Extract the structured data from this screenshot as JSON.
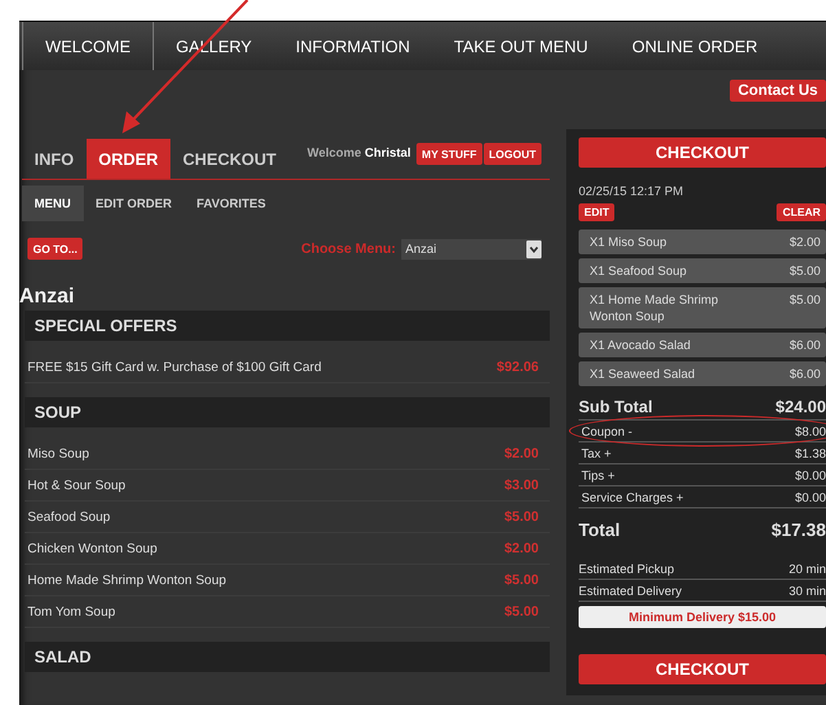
{
  "nav": [
    {
      "label": "WELCOME"
    },
    {
      "label": "GALLERY"
    },
    {
      "label": "INFORMATION"
    },
    {
      "label": "TAKE OUT MENU"
    },
    {
      "label": "ONLINE ORDER"
    }
  ],
  "contact_button": "Contact Us",
  "tabs": [
    {
      "label": "INFO",
      "selected": false
    },
    {
      "label": "ORDER",
      "selected": true
    },
    {
      "label": "CHECKOUT",
      "selected": false
    }
  ],
  "welcome": {
    "prefix": "Welcome",
    "name": "Christal"
  },
  "user_buttons": [
    "MY STUFF",
    "LOGOUT"
  ],
  "subtabs": [
    {
      "label": "MENU",
      "selected": true
    },
    {
      "label": "EDIT ORDER",
      "selected": false
    },
    {
      "label": "FAVORITES",
      "selected": false
    }
  ],
  "goto_button": "GO TO...",
  "choose_menu": {
    "label": "Choose Menu:",
    "value": "Anzai"
  },
  "menu_title": "Anzai",
  "sections": [
    {
      "title": "SPECIAL OFFERS",
      "items": [
        {
          "name": "FREE $15 Gift Card w. Purchase of $100 Gift Card",
          "price": "$92.06"
        }
      ]
    },
    {
      "title": "SOUP",
      "items": [
        {
          "name": "Miso Soup",
          "price": "$2.00"
        },
        {
          "name": "Hot & Sour Soup",
          "price": "$3.00"
        },
        {
          "name": "Seafood Soup",
          "price": "$5.00"
        },
        {
          "name": "Chicken Wonton Soup",
          "price": "$2.00"
        },
        {
          "name": "Home Made Shrimp Wonton Soup",
          "price": "$5.00"
        },
        {
          "name": "Tom Yom Soup",
          "price": "$5.00"
        }
      ]
    },
    {
      "title": "SALAD"
    }
  ],
  "cart": {
    "checkout_button": "CHECKOUT",
    "datetime": "02/25/15 12:17 PM",
    "edit_button": "EDIT",
    "clear_button": "CLEAR",
    "items": [
      {
        "name": "X1 Miso Soup",
        "price": "$2.00"
      },
      {
        "name": "X1 Seafood Soup",
        "price": "$5.00"
      },
      {
        "name": "X1 Home Made Shrimp Wonton Soup",
        "price": "$5.00"
      },
      {
        "name": "X1 Avocado Salad",
        "price": "$6.00"
      },
      {
        "name": "X1 Seaweed Salad",
        "price": "$6.00"
      }
    ],
    "subtotal": {
      "label": "Sub Total",
      "value": "$24.00"
    },
    "adjustments": [
      {
        "label": "Coupon -",
        "value": "$8.00",
        "circled": true
      },
      {
        "label": "Tax +",
        "value": "$1.38",
        "circled": false
      },
      {
        "label": "Tips +",
        "value": "$0.00",
        "circled": false
      },
      {
        "label": "Service Charges +",
        "value": "$0.00",
        "circled": false
      }
    ],
    "total": {
      "label": "Total",
      "value": "$17.38"
    },
    "estimates": [
      {
        "label": "Estimated Pickup",
        "value": "20 min"
      },
      {
        "label": "Estimated Delivery",
        "value": "30 min"
      }
    ],
    "minimum_notice": "Minimum Delivery $15.00",
    "bottom_checkout_button": "CHECKOUT"
  }
}
